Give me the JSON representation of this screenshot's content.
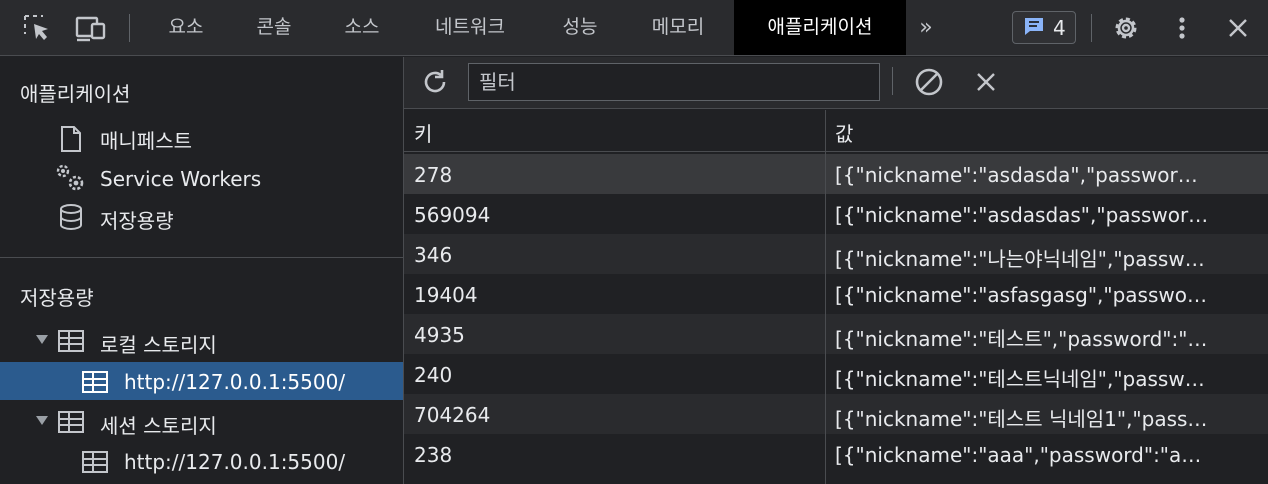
{
  "toolbar": {
    "tabs": [
      "요소",
      "콘솔",
      "소스",
      "네트워크",
      "성능",
      "메모리",
      "애플리케이션"
    ],
    "active_tab": "애플리케이션",
    "more_tabs": "»",
    "message_count": "4"
  },
  "sidebar": {
    "app_section": {
      "title": "애플리케이션",
      "items": [
        "매니페스트",
        "Service Workers",
        "저장용량"
      ]
    },
    "storage_section": {
      "title": "저장용량",
      "local_storage": "로컬 스토리지",
      "local_origin": "http://127.0.0.1:5500/",
      "session_storage": "세션 스토리지",
      "session_origin": "http://127.0.0.1:5500/"
    }
  },
  "panel": {
    "filter_placeholder": "필터",
    "columns": {
      "key": "키",
      "value": "값"
    },
    "rows": [
      {
        "key": "278",
        "value": "[{\"nickname\":\"asdasda\",\"passwor…"
      },
      {
        "key": "569094",
        "value": "[{\"nickname\":\"asdasdas\",\"passwor…"
      },
      {
        "key": "346",
        "value": "[{\"nickname\":\"나는야닉네임\",\"passw…"
      },
      {
        "key": "19404",
        "value": "[{\"nickname\":\"asfasgasg\",\"passwo…"
      },
      {
        "key": "4935",
        "value": "[{\"nickname\":\"테스트\",\"password\":\"…"
      },
      {
        "key": "240",
        "value": "[{\"nickname\":\"테스트닉네임\",\"passw…"
      },
      {
        "key": "704264",
        "value": "[{\"nickname\":\"테스트 닉네임1\",\"pass…"
      },
      {
        "key": "238",
        "value": "[{\"nickname\":\"aaa\",\"password\":\"a…"
      }
    ]
  },
  "colors": {
    "accent_selected": "#2b5b8e",
    "active_tab_bg": "#000000",
    "badge_blue": "#8ab4f8"
  }
}
